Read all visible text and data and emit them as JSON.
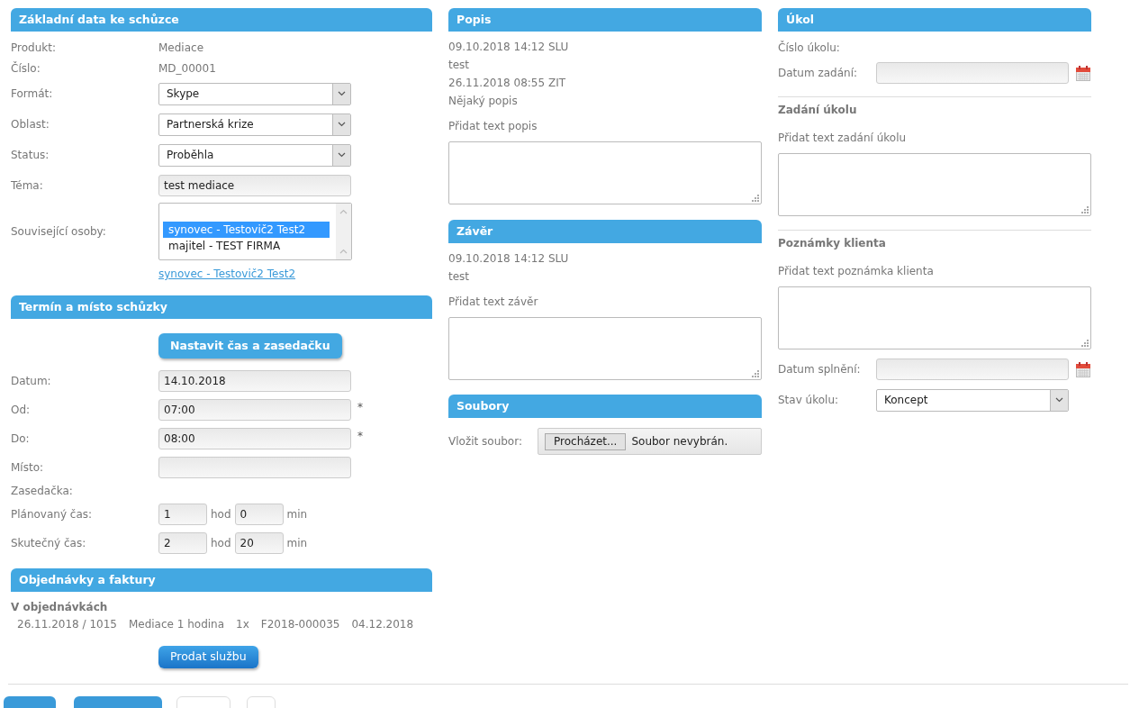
{
  "basic": {
    "title": "Základní data ke schůzce",
    "rows": [
      {
        "kind": "text",
        "label": "Produkt:",
        "value": "Mediace"
      },
      {
        "kind": "text",
        "label": "Číslo:",
        "value": "MD_00001"
      },
      {
        "kind": "select",
        "label": "Formát:",
        "value": "Skype"
      },
      {
        "kind": "select",
        "label": "Oblast:",
        "value": "Partnerská krize"
      },
      {
        "kind": "select",
        "label": "Status:",
        "value": "Proběhla"
      },
      {
        "kind": "input",
        "label": "Téma:",
        "value": "test mediace"
      },
      {
        "kind": "listbox",
        "label": "Související osoby:",
        "options": [
          {
            "text": "synovec - Testovič2 Test2",
            "selected": true
          },
          {
            "text": "majitel - TEST FIRMA",
            "selected": false
          }
        ]
      },
      {
        "kind": "link",
        "value": "synovec - Testovič2 Test2"
      }
    ]
  },
  "schedule": {
    "title": "Termín a místo schůzky",
    "button": "Nastavit čas a zasedačku",
    "rows": [
      {
        "kind": "input",
        "label": "Datum:",
        "value": "14.10.2018"
      },
      {
        "kind": "input",
        "label": "Od:",
        "value": "07:00",
        "mark": "*"
      },
      {
        "kind": "input",
        "label": "Do:",
        "value": "08:00",
        "mark": "*"
      },
      {
        "kind": "input",
        "label": "Místo:"
      },
      {
        "kind": "text",
        "label": "Zasedačka:"
      },
      {
        "kind": "duration",
        "label": "Plánovaný čas:",
        "hours": "1",
        "hours_unit": "hod",
        "minutes": "0",
        "minutes_unit": "min"
      },
      {
        "kind": "duration",
        "label": "Skutečný čas:",
        "hours": "2",
        "hours_unit": "hod",
        "minutes": "20",
        "minutes_unit": "min"
      }
    ]
  },
  "orders": {
    "title": "Objednávky a faktury",
    "subtitle": "V objednávkách",
    "rows": [
      {
        "cells": [
          "26.11.2018 / 1015",
          "Mediace 1 hodina",
          "1x",
          "F2018-000035",
          "04.12.2018"
        ]
      }
    ],
    "button": "Prodat službu"
  },
  "description": {
    "title": "Popis",
    "entries": [
      "09.10.2018 14:12 SLU",
      "test",
      "26.11.2018 08:55 ZIT",
      "Nějaký popis"
    ],
    "add_label": "Přidat text popis"
  },
  "conclusion": {
    "title": "Závěr",
    "entries": [
      "09.10.2018 14:12 SLU",
      "test"
    ],
    "add_label": "Přidat text závěr"
  },
  "files": {
    "title": "Soubory",
    "label": "Vložit soubor:",
    "browse_button": "Procházet...",
    "status": "Soubor nevybrán."
  },
  "task": {
    "title": "Úkol",
    "items": [
      {
        "kind": "text",
        "label": "Číslo úkolu:"
      },
      {
        "kind": "date",
        "label": "Datum zadání:"
      },
      {
        "kind": "section",
        "heading": "Zadání úkolu",
        "add_label": "Přidat text zadání úkolu"
      },
      {
        "kind": "section",
        "heading": "Poznámky klienta",
        "add_label": "Přidat text poznámka klienta"
      },
      {
        "kind": "date",
        "label": "Datum splnění:"
      },
      {
        "kind": "select",
        "label": "Stav úkolu:",
        "value": "Koncept"
      }
    ]
  }
}
